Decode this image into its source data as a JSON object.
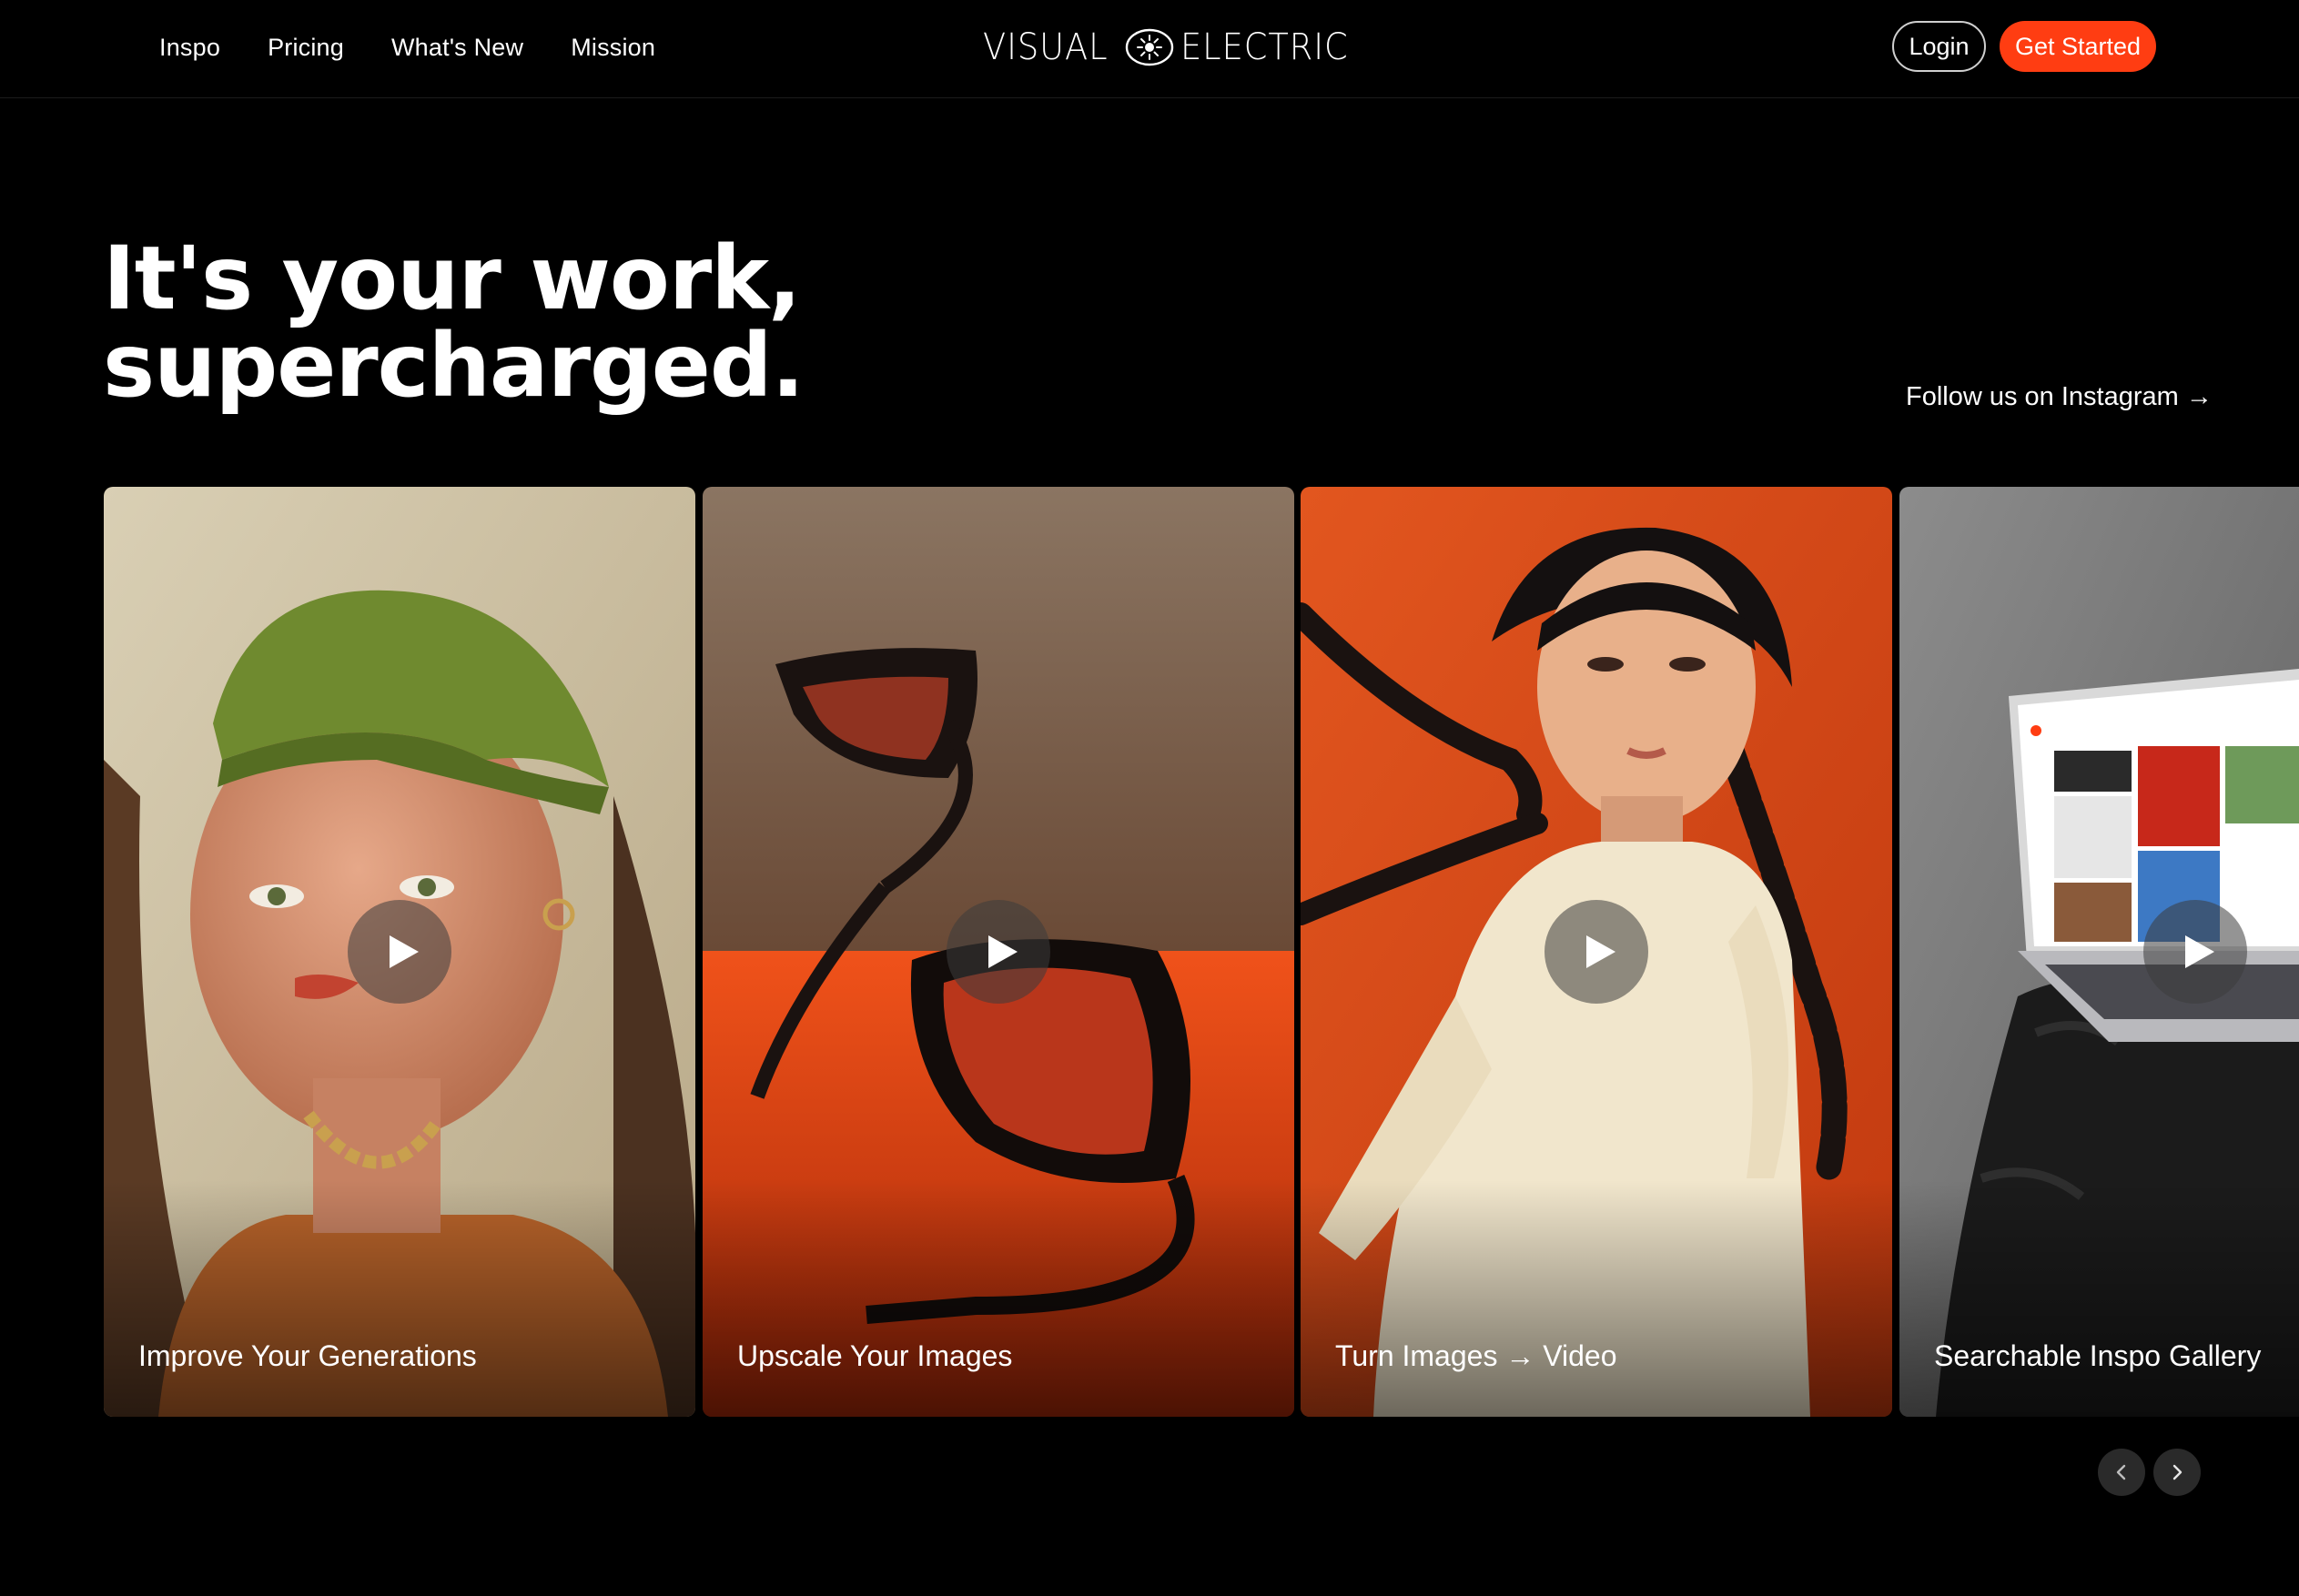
{
  "nav": {
    "links": [
      "Inspo",
      "Pricing",
      "What's New",
      "Mission"
    ],
    "logo_left": "VISUAL",
    "logo_right": "ELECTRIC",
    "login": "Login",
    "get_started": "Get Started"
  },
  "hero": {
    "title_line1": "It's your work,",
    "title_line2": "supercharged.",
    "instagram_link": "Follow us on Instagram →"
  },
  "cards": [
    {
      "label": "Improve Your Generations",
      "image": "woman-green-headscarf"
    },
    {
      "label": "Upscale Your Images",
      "image": "black-sunglasses-red-floor"
    },
    {
      "label": "Turn Images → Video",
      "image": "woman-braids-orange-background"
    },
    {
      "label": "Searchable Inspo Gallery",
      "image": "laptop-on-rock"
    }
  ],
  "icons": {
    "play": "play-icon",
    "prev": "chevron-left-icon",
    "next": "chevron-right-icon",
    "logo_mark": "sun-icon"
  },
  "colors": {
    "background": "#000000",
    "accent": "#ff3d12",
    "text": "#ffffff"
  }
}
